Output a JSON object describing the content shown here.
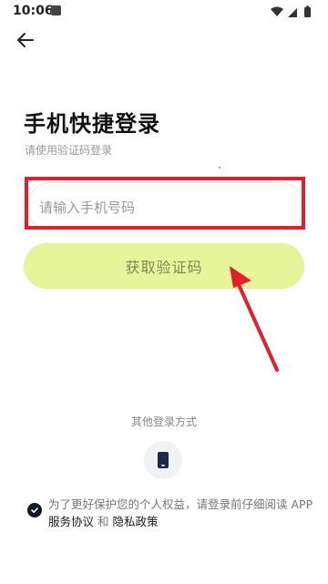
{
  "status_bar": {
    "time": "10:06",
    "icons": [
      "notification-icon",
      "wifi-icon",
      "signal-icon",
      "battery-icon"
    ]
  },
  "header": {
    "back_icon": "back-arrow-icon"
  },
  "login": {
    "title": "手机快捷登录",
    "subtitle": "请使用验证码登录",
    "phone_placeholder": "请输入手机号码",
    "phone_value": "",
    "get_code_label": "获取验证码"
  },
  "other_methods": {
    "label": "其他登录方式",
    "phone_icon": "phone-icon"
  },
  "agreement": {
    "prefix": "为了更好保护您的个人权益，请登录前仔细阅读 APP ",
    "service_link": "服务协议",
    "and": " 和 ",
    "privacy_link": "隐私政策",
    "checked": true
  },
  "colors": {
    "accent_button": "#e6f59a",
    "button_text": "#7a8a55",
    "annotation_red": "#e21f2b",
    "check_dark": "#111827"
  }
}
